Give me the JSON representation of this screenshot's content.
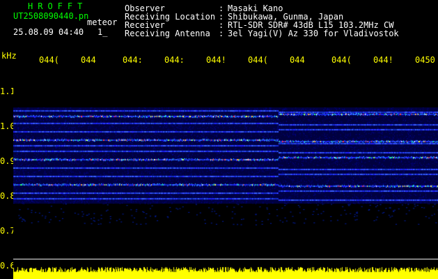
{
  "header": {
    "app_title": "HROFFT",
    "file_name": "UT2508090440.pn",
    "file_suffix": "meteor",
    "datetime": "25.08.09 04:40",
    "page_indicator": "1_"
  },
  "station": [
    {
      "label": "Observer",
      "value": "Masaki Kano"
    },
    {
      "label": "Receiving Location",
      "value": "Shibukawa, Gunma, Japan"
    },
    {
      "label": "Receiver",
      "value": "RTL-SDR SDR# 43dB L15 103.2MHz CW"
    },
    {
      "label": "Receiving Antenna",
      "value": "3el Yagi(V) Az 330 for Vladivostok"
    }
  ],
  "axes": {
    "unit": "kHz",
    "time_ticks": [
      "044(",
      "044",
      "044:",
      "044:",
      "044!",
      "044(",
      "044",
      "044(",
      "044!",
      "0450"
    ],
    "freq_ticks": [
      "1.1",
      "1.0",
      "0.9",
      "0.8",
      "0.7",
      "0.6"
    ]
  },
  "colors": {
    "background": "#000000",
    "axis_text": "#ffff00",
    "header_green": "#00ff00",
    "text_white": "#ffffff",
    "waterfall_floor": "#000040",
    "noise_bar": "#ffff00",
    "baseline": "#ffffff"
  }
}
